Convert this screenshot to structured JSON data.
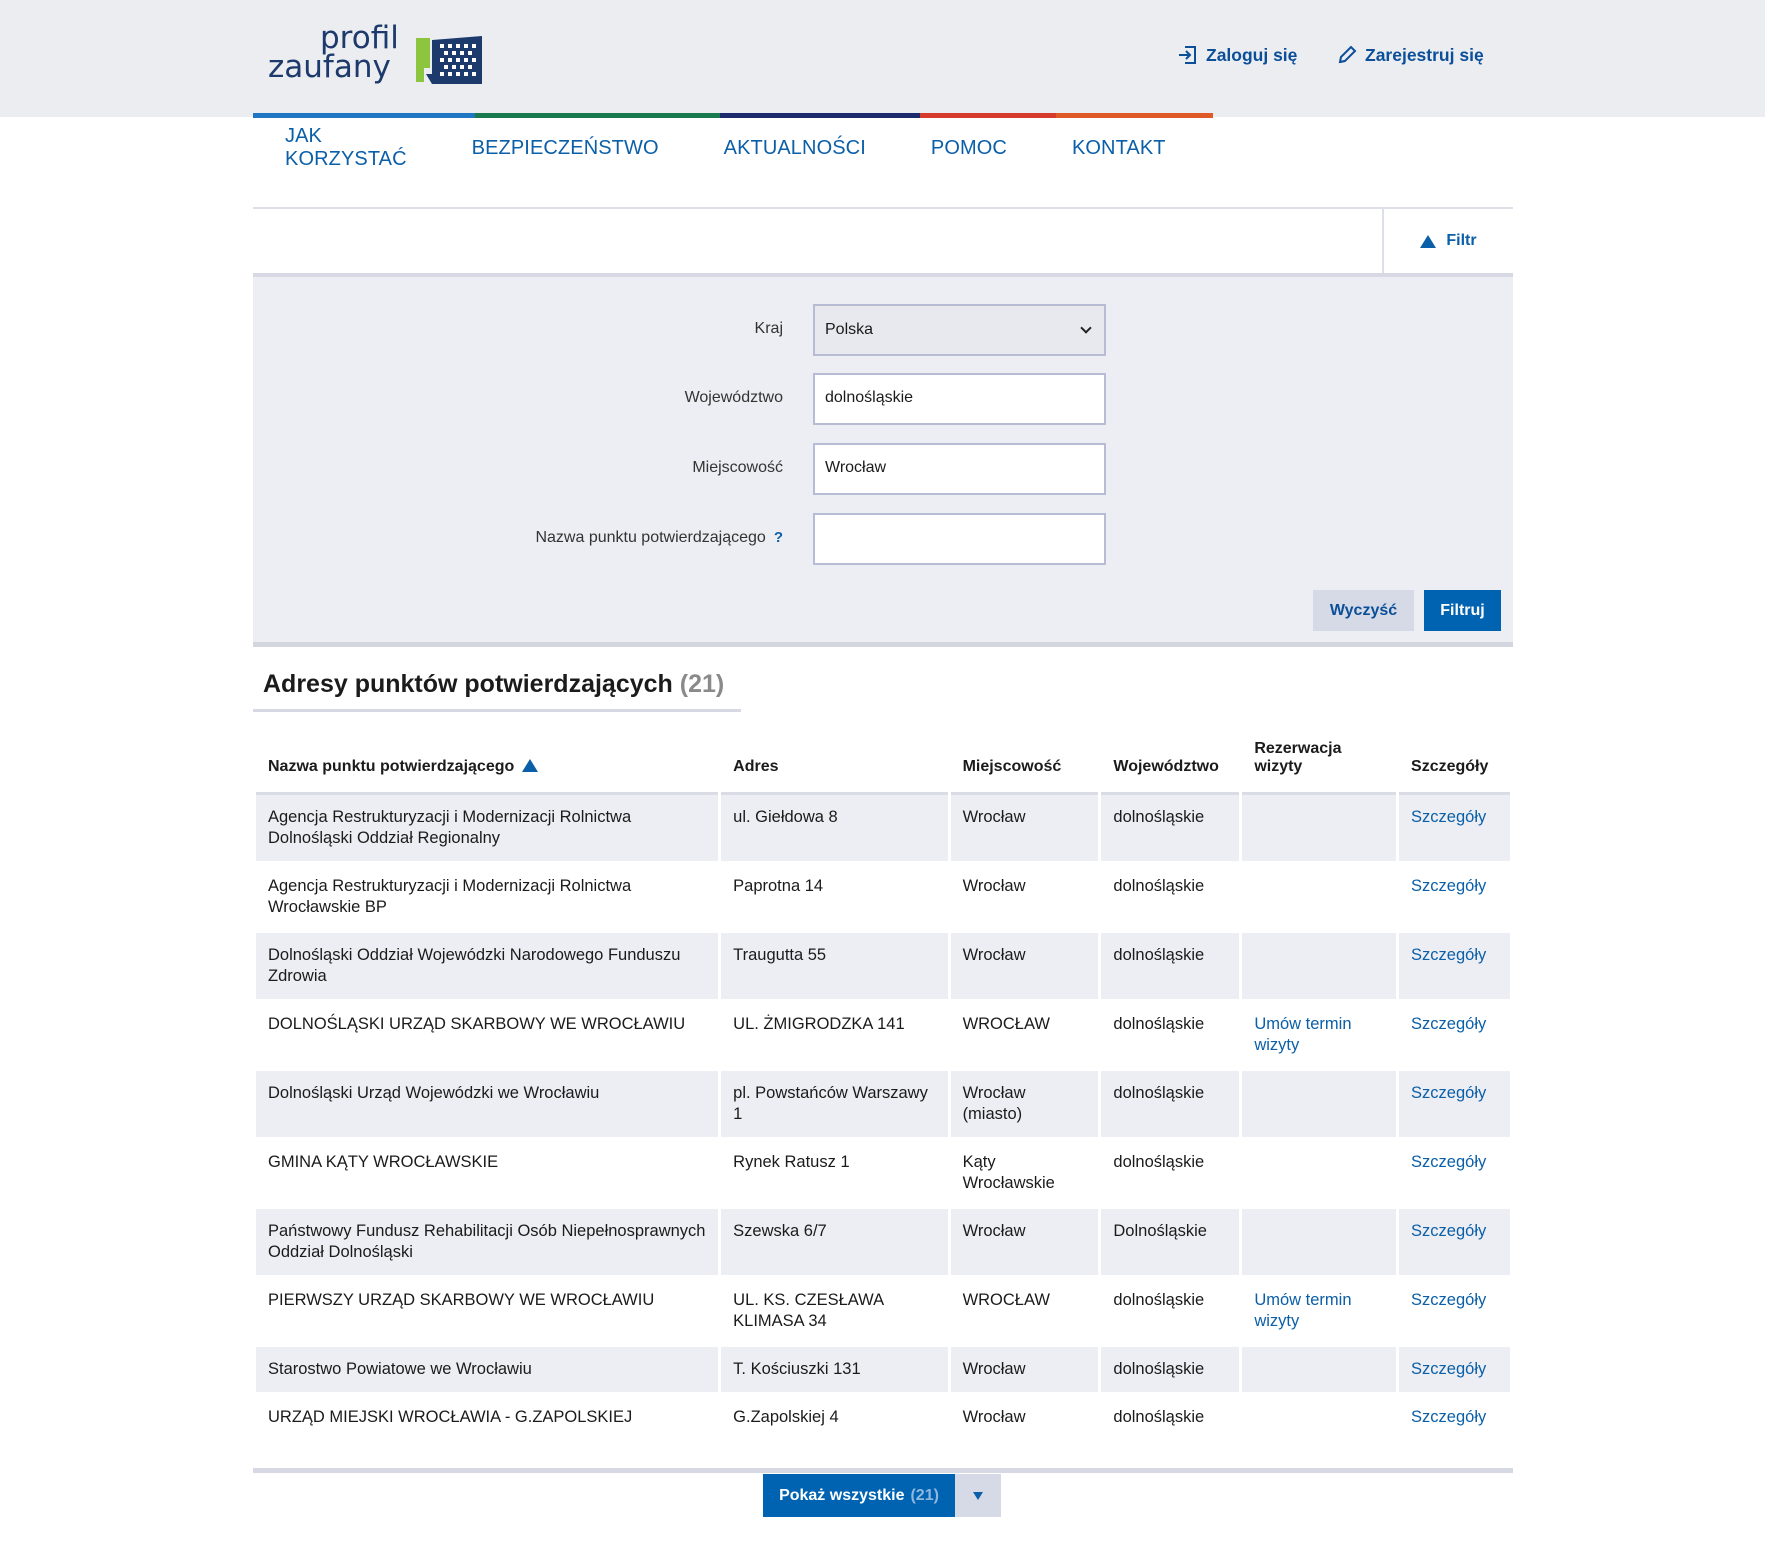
{
  "header": {
    "logo_line1": "profil",
    "logo_line2": "zaufany",
    "login_label": "Zaloguj się",
    "register_label": "Zarejestruj się",
    "strip_colors": [
      "#1f77c4",
      "#1a7a4f",
      "#1c2a6e",
      "#d63a2b",
      "#e05a27"
    ]
  },
  "nav": {
    "items": [
      "JAK KORZYSTAĆ",
      "BEZPIECZEŃSTWO",
      "AKTUALNOŚCI",
      "POMOC",
      "KONTAKT"
    ]
  },
  "filter": {
    "toggle_label": "Filtr",
    "fields": [
      {
        "label": "Kraj",
        "value": "Polska"
      },
      {
        "label": "Województwo",
        "value": "dolnośląskie"
      },
      {
        "label": "Miejscowość",
        "value": "Wrocław"
      },
      {
        "label": "Nazwa punktu potwierdzającego",
        "value": "",
        "help": "?"
      }
    ],
    "clear_label": "Wyczyść",
    "filter_label": "Filtruj"
  },
  "results": {
    "title": "Adresy punktów potwierdzających",
    "count": "(21)",
    "columns": [
      "Nazwa punktu potwierdzającego",
      "Adres",
      "Miejscowość",
      "Województwo",
      "Rezerwacja wizyty",
      "Szczegóły"
    ],
    "rows": [
      {
        "name": "Agencja Restrukturyzacji i Modernizacji Rolnictwa Dolnośląski Oddział Regionalny",
        "address": "ul. Giełdowa 8",
        "city": "Wrocław",
        "voivodeship": "dolnośląskie",
        "booking": "",
        "details": "Szczegóły"
      },
      {
        "name": "Agencja Restrukturyzacji i Modernizacji Rolnictwa Wrocławskie BP",
        "address": "Paprotna 14",
        "city": "Wrocław",
        "voivodeship": "dolnośląskie",
        "booking": "",
        "details": "Szczegóły"
      },
      {
        "name": "Dolnośląski Oddział Wojewódzki Narodowego Funduszu Zdrowia",
        "address": "Traugutta 55",
        "city": "Wrocław",
        "voivodeship": "dolnośląskie",
        "booking": "",
        "details": "Szczegóły"
      },
      {
        "name": "DOLNOŚLĄSKI URZĄD SKARBOWY WE WROCŁAWIU",
        "address": "UL. ŻMIGRODZKA 141",
        "city": "WROCŁAW",
        "voivodeship": "dolnośląskie",
        "booking": "Umów termin wizyty",
        "details": "Szczegóły"
      },
      {
        "name": "Dolnośląski Urząd Wojewódzki we Wrocławiu",
        "address": "pl. Powstańców Warszawy 1",
        "city": "Wrocław (miasto)",
        "voivodeship": "dolnośląskie",
        "booking": "",
        "details": "Szczegóły"
      },
      {
        "name": "GMINA KĄTY WROCŁAWSKIE",
        "address": "Rynek Ratusz 1",
        "city": "Kąty Wrocławskie",
        "voivodeship": "dolnośląskie",
        "booking": "",
        "details": "Szczegóły"
      },
      {
        "name": "Państwowy Fundusz Rehabilitacji Osób Niepełnosprawnych Oddział Dolnośląski",
        "address": "Szewska 6/7",
        "city": "Wrocław",
        "voivodeship": "Dolnośląskie",
        "booking": "",
        "details": "Szczegóły"
      },
      {
        "name": "PIERWSZY URZĄD SKARBOWY WE WROCŁAWIU",
        "address": "UL. KS. CZESŁAWA KLIMASA 34",
        "city": "WROCŁAW",
        "voivodeship": "dolnośląskie",
        "booking": "Umów termin wizyty",
        "details": "Szczegóły"
      },
      {
        "name": "Starostwo Powiatowe we Wrocławiu",
        "address": "T. Kościuszki 131",
        "city": "Wrocław",
        "voivodeship": "dolnośląskie",
        "booking": "",
        "details": "Szczegóły"
      },
      {
        "name": "URZĄD MIEJSKI WROCŁAWIA - G.ZAPOLSKIEJ",
        "address": "G.Zapolskiej 4",
        "city": "Wrocław",
        "voivodeship": "dolnośląskie",
        "booking": "",
        "details": "Szczegóły"
      }
    ],
    "show_all_label": "Pokaż wszystkie",
    "show_all_count": "(21)"
  }
}
